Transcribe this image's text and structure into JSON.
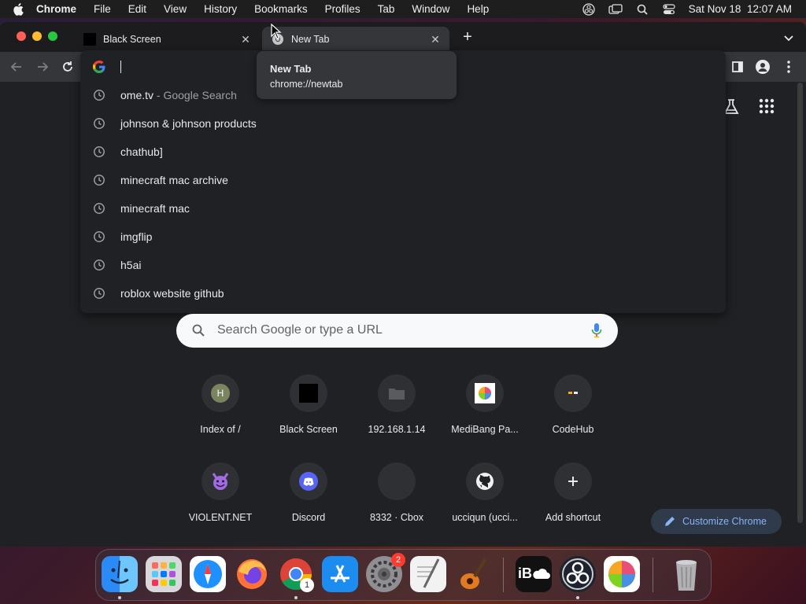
{
  "menubar": {
    "app_name": "Chrome",
    "items": [
      "File",
      "Edit",
      "View",
      "History",
      "Bookmarks",
      "Profiles",
      "Tab",
      "Window",
      "Help"
    ],
    "clock": "Sat Nov 18  12:07 AM"
  },
  "tabs": [
    {
      "title": "Black Screen",
      "active": false
    },
    {
      "title": "New Tab",
      "active": true
    }
  ],
  "hovercard": {
    "title": "New Tab",
    "url": "chrome://newtab"
  },
  "omnibox": {
    "value": "",
    "suggestions": [
      {
        "text": "ome.tv",
        "sub": " - Google Search"
      },
      {
        "text": "johnson & johnson products",
        "sub": ""
      },
      {
        "text": "chathub]",
        "sub": ""
      },
      {
        "text": "minecraft mac archive",
        "sub": ""
      },
      {
        "text": "minecraft mac",
        "sub": ""
      },
      {
        "text": "imgflip",
        "sub": ""
      },
      {
        "text": "h5ai",
        "sub": ""
      },
      {
        "text": "roblox website github",
        "sub": ""
      }
    ]
  },
  "ntp": {
    "search_placeholder": "Search Google or type a URL",
    "shortcuts": [
      {
        "label": "Index of /",
        "initial": "H"
      },
      {
        "label": "Black Screen",
        "initial": ""
      },
      {
        "label": "192.168.1.14",
        "initial": ""
      },
      {
        "label": "MediBang Pa...",
        "initial": ""
      },
      {
        "label": "CodeHub",
        "initial": ""
      },
      {
        "label": "VIOLENT.NET",
        "initial": ""
      },
      {
        "label": "Discord",
        "initial": ""
      },
      {
        "label": "8332 · Cbox",
        "initial": ""
      },
      {
        "label": "ucciqun (ucci...",
        "initial": ""
      },
      {
        "label": "Add shortcut",
        "initial": ""
      }
    ],
    "customize_label": "Customize Chrome"
  },
  "dock": {
    "settings_badge": "2",
    "chrome_badge": "1",
    "ib_text": "iB"
  },
  "colors": {
    "accent": "#8ab4f8",
    "window_bg": "#202124",
    "toolbar_bg": "#35363a"
  }
}
